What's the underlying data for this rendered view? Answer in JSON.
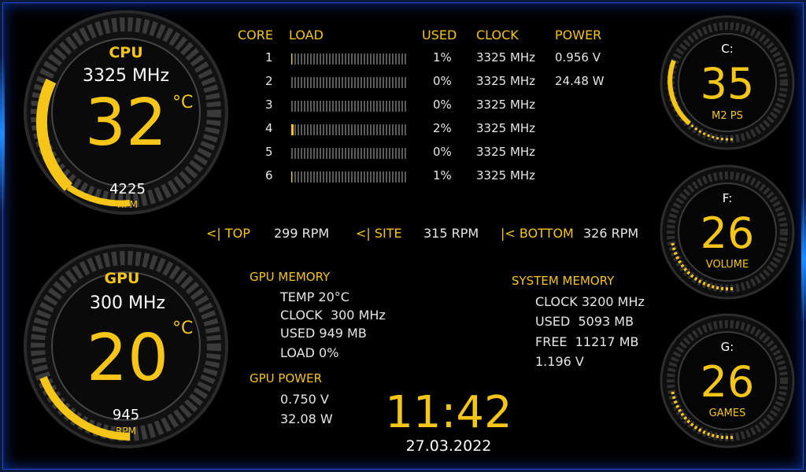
{
  "cpu": {
    "label": "CPU",
    "frequency": "3325 MHz",
    "temp": "32",
    "temp_unit": "°C",
    "fan": "4225",
    "fan_unit": "RPM"
  },
  "gpu": {
    "label": "GPU",
    "frequency": "300 MHz",
    "temp": "20",
    "temp_unit": "°C",
    "fan": "945",
    "fan_unit": "RPM"
  },
  "core_table": {
    "headers": {
      "core": "CORE",
      "load": "LOAD",
      "used": "USED",
      "clock": "CLOCK",
      "power": "POWER"
    },
    "rows": [
      {
        "core": "1",
        "load_pct": 1,
        "used": "1%",
        "clock": "3325 MHz",
        "power": "0.956 V"
      },
      {
        "core": "2",
        "load_pct": 0,
        "used": "0%",
        "clock": "3325 MHz",
        "power": "24.48 W"
      },
      {
        "core": "3",
        "load_pct": 0,
        "used": "0%",
        "clock": "3325 MHz",
        "power": ""
      },
      {
        "core": "4",
        "load_pct": 2,
        "used": "2%",
        "clock": "3325 MHz",
        "power": ""
      },
      {
        "core": "5",
        "load_pct": 0,
        "used": "0%",
        "clock": "3325 MHz",
        "power": ""
      },
      {
        "core": "6",
        "load_pct": 1,
        "used": "1%",
        "clock": "3325 MHz",
        "power": ""
      }
    ]
  },
  "fans": {
    "top_label": "<| TOP",
    "top_value": "299 RPM",
    "site_label": "<| SITE",
    "site_value": "315 RPM",
    "bottom_label": "|< BOTTOM",
    "bottom_value": "326 RPM"
  },
  "gpu_memory": {
    "title": "GPU MEMORY",
    "temp": "TEMP 20°C",
    "clock": "CLOCK  300 MHz",
    "used": "USED 949 MB",
    "load": "LOAD 0%"
  },
  "gpu_power": {
    "title": "GPU POWER",
    "voltage": "0.750 V",
    "watts": "32.08 W"
  },
  "system_memory": {
    "title": "SYSTEM MEMORY",
    "clock": "CLOCK 3200 MHz",
    "used": "USED  5093 MB",
    "free": "FREE  11217 MB",
    "voltage": "1.196 V"
  },
  "time": "11:42",
  "date": "27.03.2022",
  "drives": [
    {
      "letter": "C:",
      "temp": "35",
      "name": "M2 PS"
    },
    {
      "letter": "F:",
      "temp": "26",
      "name": "VOLUME"
    },
    {
      "letter": "G:",
      "temp": "26",
      "name": "GAMES"
    }
  ],
  "colors": {
    "accent": "#f5c518",
    "background": "#000000",
    "frame": "#1b4fd1"
  }
}
